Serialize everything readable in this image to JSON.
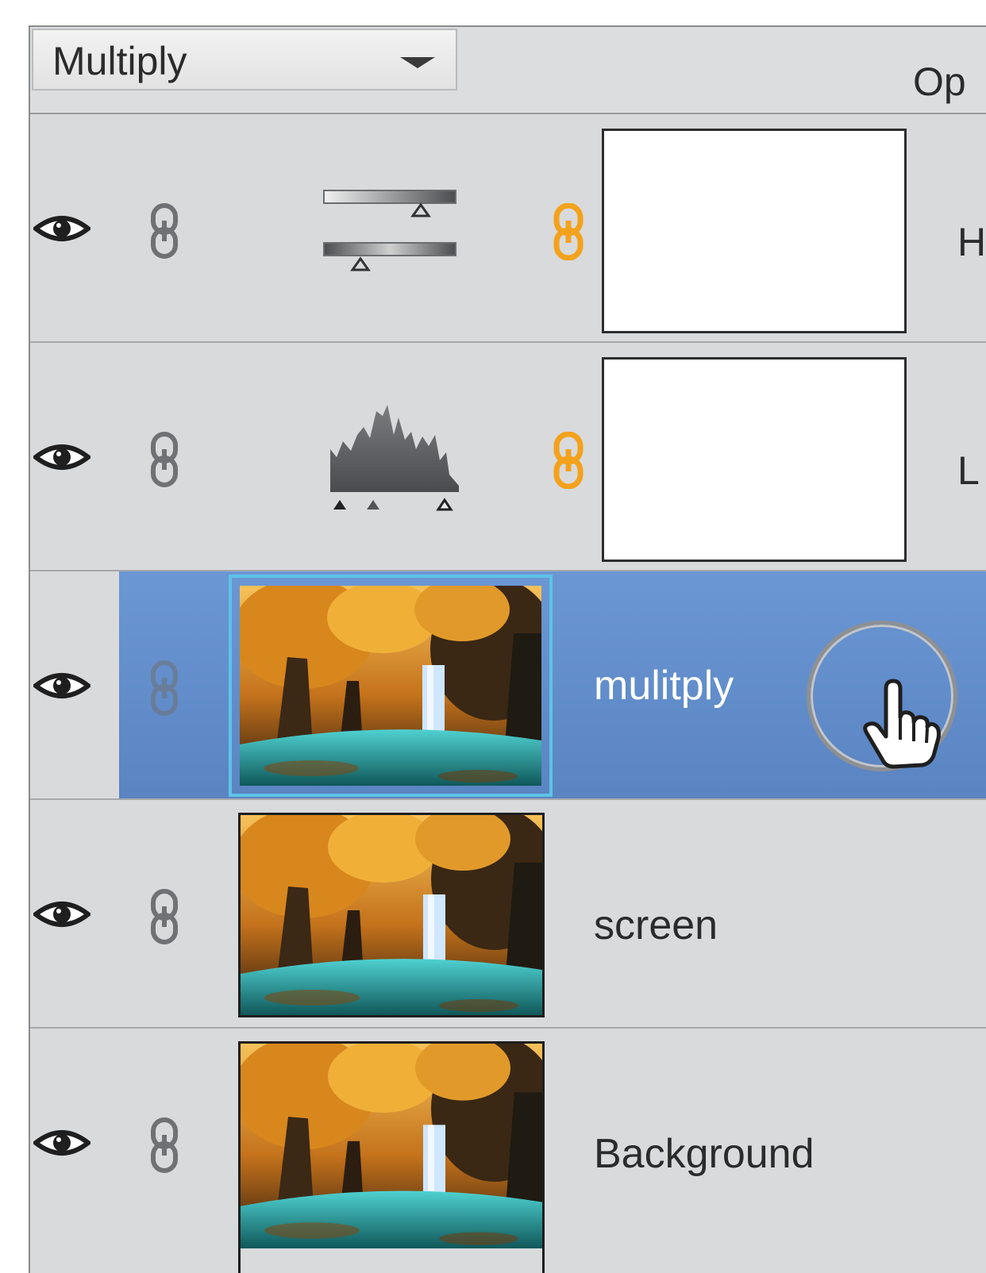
{
  "blend_mode": {
    "value": "Multiply"
  },
  "opacity_label": "Op",
  "icons": {
    "visibility": "eye-icon",
    "link": "chain-link-icon",
    "mask_link": "chain-link-icon",
    "cursor": "hand-pointer-icon"
  },
  "colors": {
    "panel_bg": "#d9dadc",
    "selection": "#6b97d4",
    "selection_border": "#5dc3e6",
    "mask_link": "#f3a21c"
  },
  "layers": [
    {
      "type": "adjustment",
      "adjustment_icon": "hue-saturation-sliders-icon",
      "name_partial": "H",
      "mask": "white"
    },
    {
      "type": "adjustment",
      "adjustment_icon": "levels-histogram-icon",
      "name_partial": "L",
      "mask": "white"
    },
    {
      "type": "image",
      "name": "mulitply",
      "selected": true,
      "thumbnail": "forest-waterfall-thumbnail"
    },
    {
      "type": "image",
      "name": "screen",
      "selected": false,
      "thumbnail": "forest-waterfall-thumbnail"
    },
    {
      "type": "image",
      "name": "Background",
      "selected": false,
      "thumbnail": "forest-waterfall-thumbnail"
    }
  ]
}
